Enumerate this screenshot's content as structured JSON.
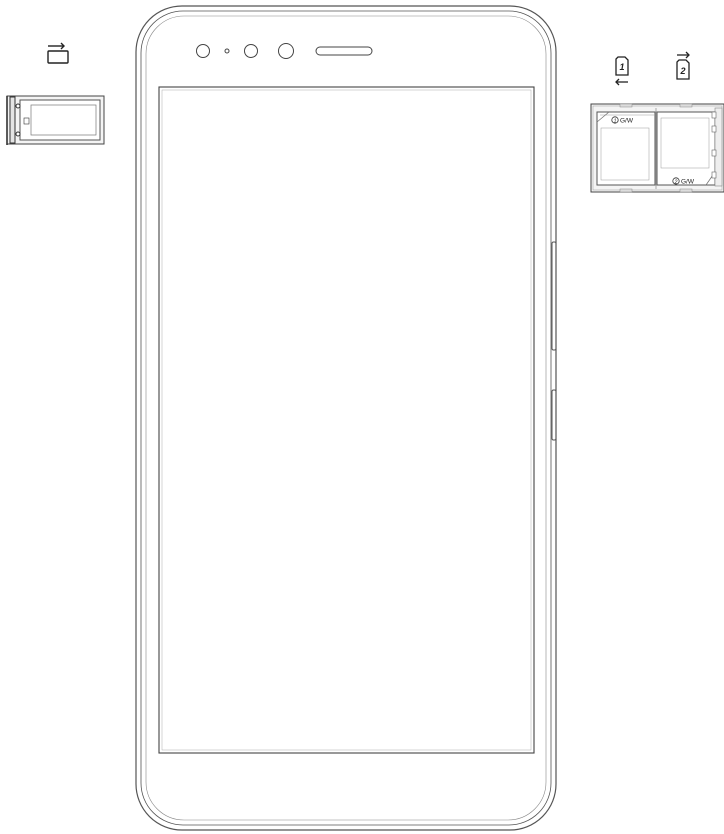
{
  "diagram": {
    "sim_tray": {
      "slot_labels": [
        "1",
        "2"
      ],
      "gw_marks": [
        "G/W",
        "G/W"
      ]
    },
    "icons": {
      "memory_card": "sd-card-insert-icon",
      "sim_1": "sim-slot-1-icon",
      "sim_2": "sim-slot-2-icon"
    },
    "colors": {
      "line": "#222222",
      "outline": "#555555",
      "fill_light": "#f4f4f4",
      "background": "#ffffff"
    }
  }
}
